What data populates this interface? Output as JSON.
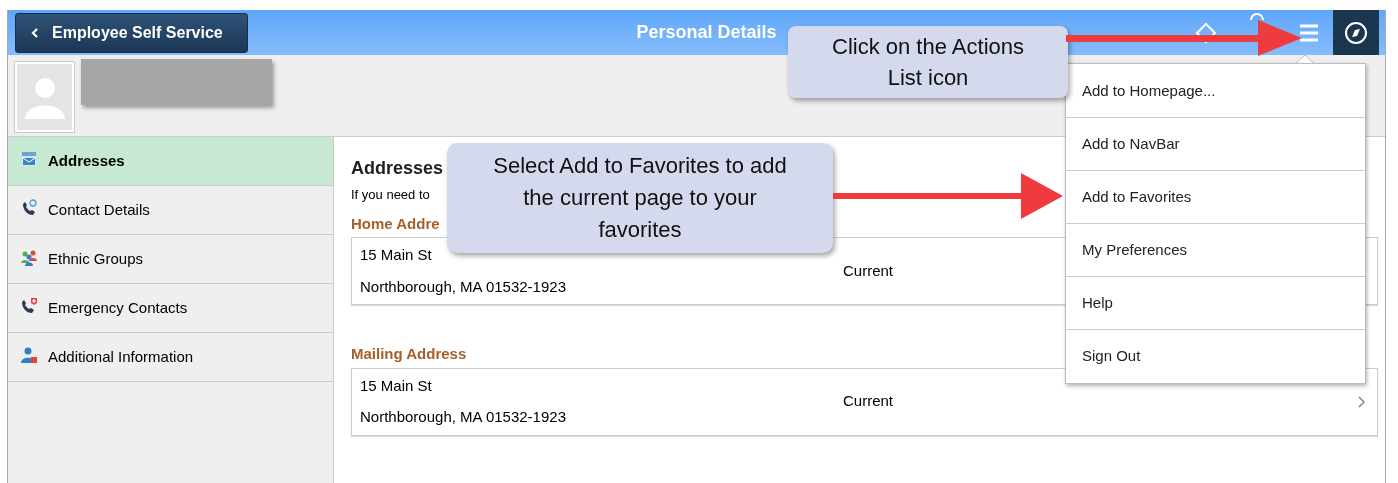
{
  "header": {
    "back_button": "Employee Self Service",
    "title": "Personal Details"
  },
  "sidebar": {
    "items": [
      {
        "label": "Addresses",
        "selected": true
      },
      {
        "label": "Contact Details",
        "selected": false
      },
      {
        "label": "Ethnic Groups",
        "selected": false
      },
      {
        "label": "Emergency Contacts",
        "selected": false
      },
      {
        "label": "Additional Information",
        "selected": false
      }
    ]
  },
  "content": {
    "heading": "Addresses",
    "intro": "If you need to",
    "sections": [
      {
        "title": "Home Addre",
        "line1": "15 Main St",
        "line2": "Northborough, MA 01532-1923",
        "status": "Current"
      },
      {
        "title": "Mailing Address",
        "line1": "15 Main St",
        "line2": "Northborough, MA 01532-1923",
        "status": "Current"
      }
    ]
  },
  "actions_menu": {
    "items": [
      "Add to Homepage...",
      "Add to NavBar",
      "Add to Favorites",
      "My Preferences",
      "Help",
      "Sign Out"
    ]
  },
  "callouts": [
    "Click on the Actions List icon",
    "Select Add to Favorites to add the current page to your favorites"
  ]
}
